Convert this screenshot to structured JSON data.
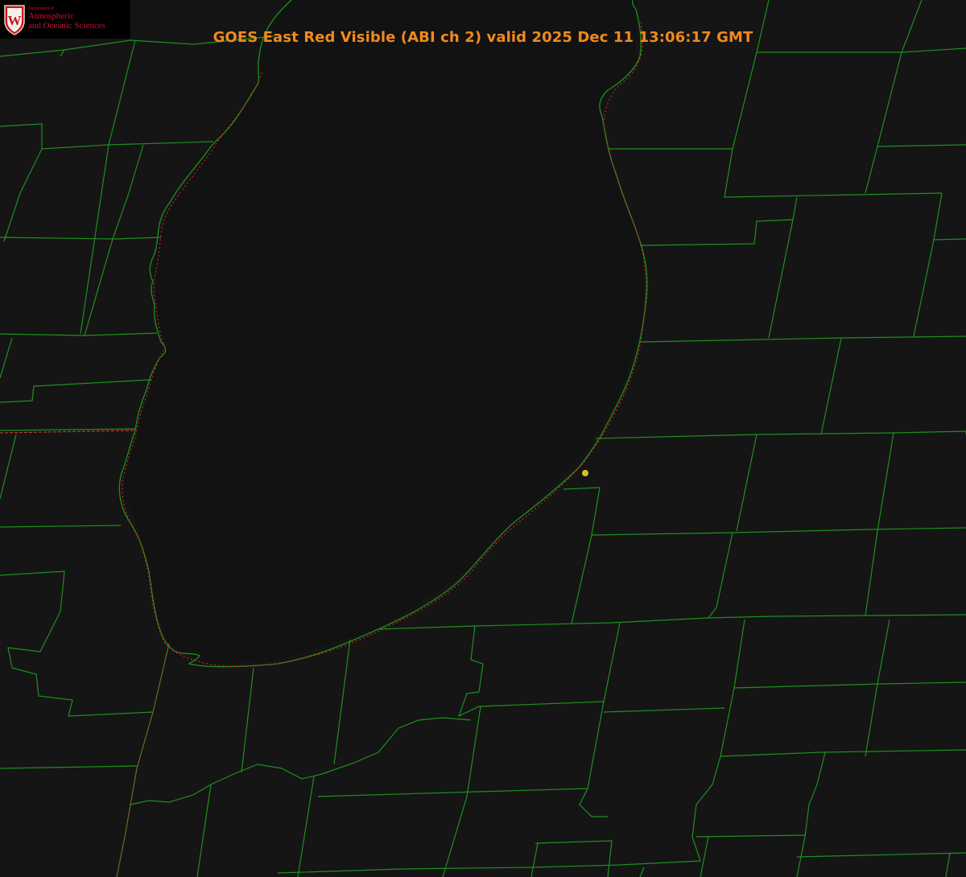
{
  "header": {
    "title": "GOES East Red Visible (ABI ch 2) valid 2025 Dec 11 13:06:17 GMT"
  },
  "logo": {
    "department_small": "Department of",
    "line1": "Atmospheric",
    "line2": "and Oceanic Sciences",
    "crest_letter": "W"
  },
  "colors": {
    "background": "#151515",
    "boundary_lines": "#1f8f1f",
    "shoreline_dotted": "#e02020",
    "title_text": "#f08a1e",
    "logo_text": "#c8102e",
    "marker": "#d6c21c"
  }
}
